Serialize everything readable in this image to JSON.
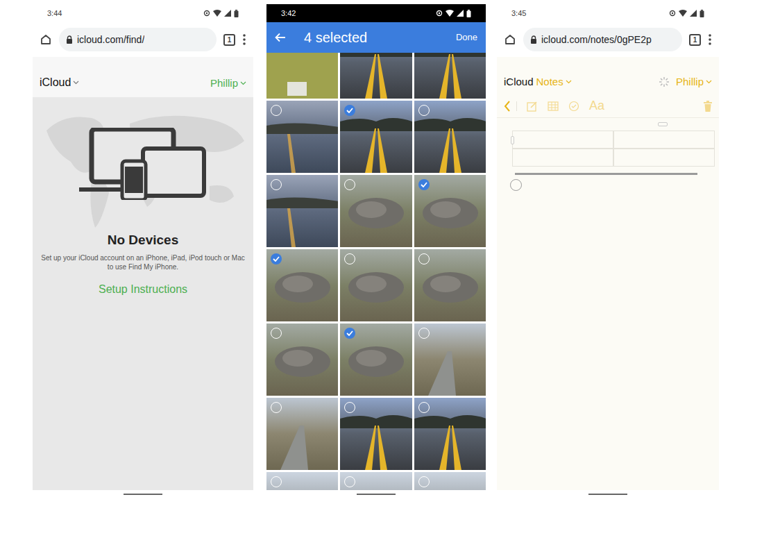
{
  "screens": [
    {
      "kind": "find",
      "status_time": "3:44",
      "url": "icloud.com/find/",
      "tab_count": "1",
      "app_title": "iCloud",
      "user": "Phillip",
      "heading": "No Devices",
      "message": "Set up your iCloud account on an iPhone, iPad, iPod touch or Mac to use Find My iPhone.",
      "link": "Setup Instructions"
    },
    {
      "kind": "photos",
      "status_time": "3:42",
      "title": "4 selected",
      "action": "Done",
      "photos": [
        [
          {
            "kind": "box",
            "selected": false
          },
          {
            "kind": "road",
            "selected": false
          },
          {
            "kind": "road",
            "selected": false
          }
        ],
        [
          {
            "kind": "lake",
            "selected": false
          },
          {
            "kind": "road",
            "selected": true
          },
          {
            "kind": "road",
            "selected": false
          }
        ],
        [
          {
            "kind": "lake",
            "selected": false
          },
          {
            "kind": "sculpture",
            "selected": false
          },
          {
            "kind": "sculpture",
            "selected": true
          }
        ],
        [
          {
            "kind": "sculpture",
            "selected": true
          },
          {
            "kind": "sculpture",
            "selected": false
          },
          {
            "kind": "sculpture",
            "selected": false
          }
        ],
        [
          {
            "kind": "sculpture",
            "selected": false
          },
          {
            "kind": "sculpture",
            "selected": true
          },
          {
            "kind": "path",
            "selected": false
          }
        ],
        [
          {
            "kind": "path",
            "selected": false
          },
          {
            "kind": "road",
            "selected": false
          },
          {
            "kind": "road",
            "selected": false
          }
        ],
        [
          {
            "kind": "trees",
            "selected": false
          },
          {
            "kind": "trees",
            "selected": false
          },
          {
            "kind": "trees",
            "selected": false
          }
        ]
      ]
    },
    {
      "kind": "notes",
      "status_time": "3:45",
      "url": "icloud.com/notes/0gPE2p",
      "tab_count": "1",
      "app_title": "iCloud",
      "section": "Notes",
      "user": "Phillip",
      "format_label": "Aa",
      "note": {
        "table": [
          [
            "",
            ""
          ],
          [
            "",
            ""
          ]
        ],
        "checklist": [
          {
            "text": "",
            "checked": false
          }
        ]
      }
    }
  ]
}
